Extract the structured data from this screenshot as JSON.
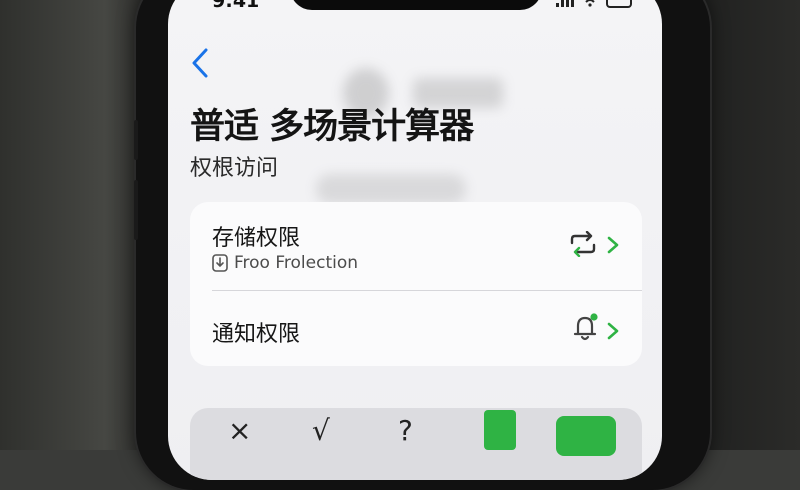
{
  "status_bar": {
    "time": "9:41"
  },
  "nav": {
    "back_icon": "chevron-left-icon"
  },
  "page": {
    "title": "普适 多场景计算器",
    "subtitle": "权根访问"
  },
  "permissions": [
    {
      "label": "存储权限",
      "sub_icon": "download-file-icon",
      "sub_text": "Froo Frolection",
      "icon": "sync-arrows-icon"
    },
    {
      "label": "通知权限",
      "icon": "bell-icon"
    }
  ],
  "keyboard": {
    "keys": [
      "×",
      "√",
      "?"
    ]
  },
  "colors": {
    "accent": "#1a73e8",
    "green": "#2fb344",
    "card": "#fbfbfc",
    "screen": "#f2f2f4"
  }
}
